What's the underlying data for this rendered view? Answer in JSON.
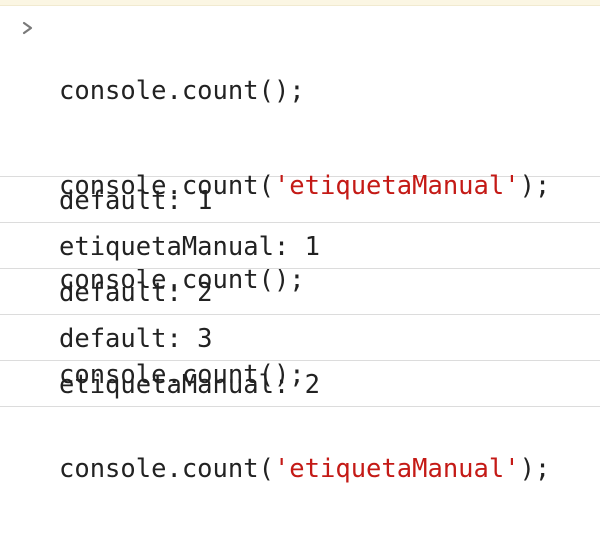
{
  "console": {
    "input_lines": [
      {
        "prefix": "console.count(",
        "arg": "",
        "suffix": ");"
      },
      {
        "prefix": "console.count(",
        "arg": "'etiquetaManual'",
        "suffix": ");"
      },
      {
        "prefix": "console.count(",
        "arg": "",
        "suffix": ");"
      },
      {
        "prefix": "console.count(",
        "arg": "",
        "suffix": ");"
      },
      {
        "prefix": "console.count(",
        "arg": "'etiquetaManual'",
        "suffix": ");"
      }
    ],
    "outputs": [
      "default: 1",
      "etiquetaManual: 1",
      "default: 2",
      "default: 3",
      "etiquetaManual: 2"
    ],
    "prompt_icon": "chevron-right-icon",
    "string_color": "#c41a16"
  }
}
